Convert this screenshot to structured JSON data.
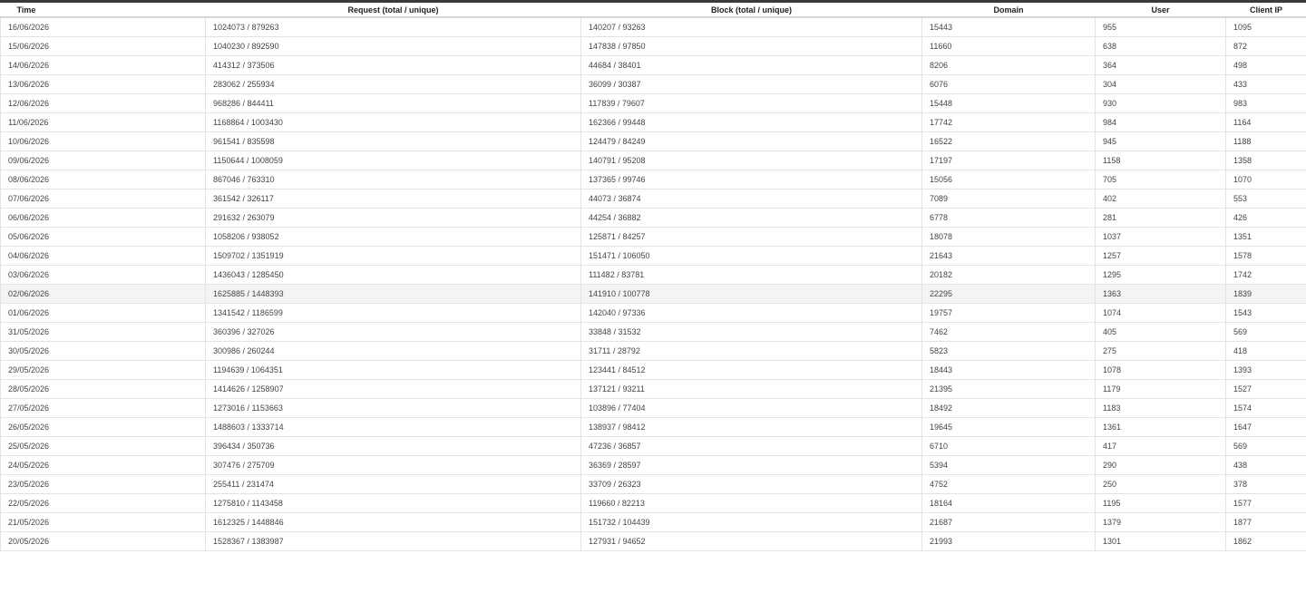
{
  "table": {
    "headers": {
      "time": "Time",
      "request": "Request (total / unique)",
      "block": "Block (total / unique)",
      "domain": "Domain",
      "user": "User",
      "client_ip": "Client IP"
    },
    "highlighted_row_index": 14,
    "rows": [
      [
        "16/06/2026",
        "1024073 / 879263",
        "140207 / 93263",
        "15443",
        "955",
        "1095"
      ],
      [
        "15/06/2026",
        "1040230 / 892590",
        "147838 / 97850",
        "11660",
        "638",
        "872"
      ],
      [
        "14/06/2026",
        "414312 / 373506",
        "44684 / 38401",
        "8206",
        "364",
        "498"
      ],
      [
        "13/06/2026",
        "283062 / 255934",
        "36099 / 30387",
        "6076",
        "304",
        "433"
      ],
      [
        "12/06/2026",
        "968286 / 844411",
        "117839 / 79607",
        "15448",
        "930",
        "983"
      ],
      [
        "11/06/2026",
        "1168864 / 1003430",
        "162366 / 99448",
        "17742",
        "984",
        "1164"
      ],
      [
        "10/06/2026",
        "961541 / 835598",
        "124479 / 84249",
        "16522",
        "945",
        "1188"
      ],
      [
        "09/06/2026",
        "1150644 / 1008059",
        "140791 / 95208",
        "17197",
        "1158",
        "1358"
      ],
      [
        "08/06/2026",
        "867046 / 763310",
        "137365 / 99746",
        "15056",
        "705",
        "1070"
      ],
      [
        "07/06/2026",
        "361542 / 326117",
        "44073 / 36874",
        "7089",
        "402",
        "553"
      ],
      [
        "06/06/2026",
        "291632 / 263079",
        "44254 / 36882",
        "6778",
        "281",
        "426"
      ],
      [
        "05/06/2026",
        "1058206 / 938052",
        "125871 / 84257",
        "18078",
        "1037",
        "1351"
      ],
      [
        "04/06/2026",
        "1509702 / 1351919",
        "151471 / 106050",
        "21643",
        "1257",
        "1578"
      ],
      [
        "03/06/2026",
        "1436043 / 1285450",
        "111482 / 83781",
        "20182",
        "1295",
        "1742"
      ],
      [
        "02/06/2026",
        "1625885 / 1448393",
        "141910 / 100778",
        "22295",
        "1363",
        "1839"
      ],
      [
        "01/06/2026",
        "1341542 / 1186599",
        "142040 / 97336",
        "19757",
        "1074",
        "1543"
      ],
      [
        "31/05/2026",
        "360396 / 327026",
        "33848 / 31532",
        "7462",
        "405",
        "569"
      ],
      [
        "30/05/2026",
        "300986 / 260244",
        "31711 / 28792",
        "5823",
        "275",
        "418"
      ],
      [
        "29/05/2026",
        "1194639 / 1064351",
        "123441 / 84512",
        "18443",
        "1078",
        "1393"
      ],
      [
        "28/05/2026",
        "1414626 / 1258907",
        "137121 / 93211",
        "21395",
        "1179",
        "1527"
      ],
      [
        "27/05/2026",
        "1273016 / 1153663",
        "103896 / 77404",
        "18492",
        "1183",
        "1574"
      ],
      [
        "26/05/2026",
        "1488603 / 1333714",
        "138937 / 98412",
        "19645",
        "1361",
        "1647"
      ],
      [
        "25/05/2026",
        "396434 / 350736",
        "47236 / 36857",
        "6710",
        "417",
        "569"
      ],
      [
        "24/05/2026",
        "307476 / 275709",
        "36369 / 28597",
        "5394",
        "290",
        "438"
      ],
      [
        "23/05/2026",
        "255411 / 231474",
        "33709 / 26323",
        "4752",
        "250",
        "378"
      ],
      [
        "22/05/2026",
        "1275810 / 1143458",
        "119660 / 82213",
        "18164",
        "1195",
        "1577"
      ],
      [
        "21/05/2026",
        "1612325 / 1448846",
        "151732 / 104439",
        "21687",
        "1379",
        "1877"
      ],
      [
        "20/05/2026",
        "1528367 / 1383987",
        "127931 / 94652",
        "21993",
        "1301",
        "1862"
      ]
    ]
  }
}
